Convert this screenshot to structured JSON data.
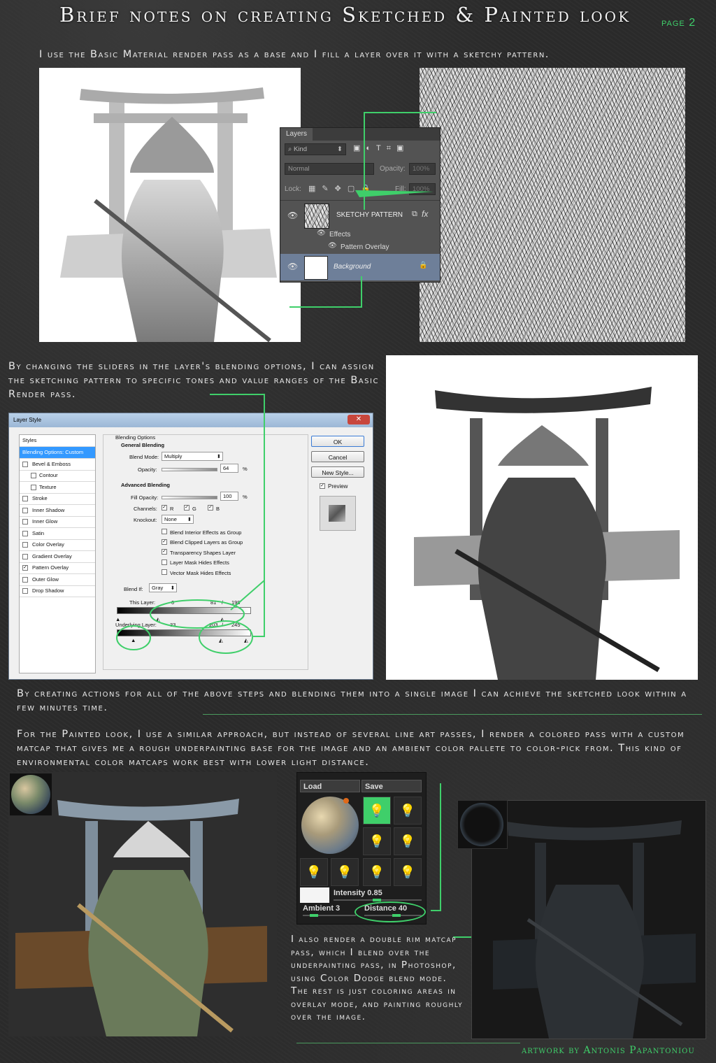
{
  "title": "Brief notes on creating Sketched & Painted look",
  "page_label": "page 2",
  "para1": "I use the Basic Material render pass as a base and I fill a layer over it with a sketchy pattern.",
  "para2": "By changing the sliders in the layer's blending options, I can assign the sketching pattern to specific tones and value ranges of the Basic Render pass.",
  "para3": "By creating actions for all of the above steps and blending them into a single image I can achieve the sketched look within a few minutes time.",
  "para4": "For the Painted look, I use a similar approach, but instead of several line art passes, I render a colored pass with a custom matcap that gives me a rough underpainting base for the image and an ambient color pallete to color-pick from. This kind of environmental color matcaps work best with lower light distance.",
  "para5": "I also render a double rim matcap pass, which I blend over the underpainting pass, in Photoshop, using Color Dodge blend mode.\nThe rest is just coloring areas in overlay mode, and painting roughly over the image.",
  "credit": "artwork by Antonis Papantoniou",
  "layers_panel": {
    "tab": "Layers",
    "kind": "Kind",
    "blend_mode": "Normal",
    "opacity_label": "Opacity:",
    "opacity_value": "100%",
    "lock_label": "Lock:",
    "fill_label": "Fill:",
    "fill_value": "100%",
    "layer1": "SKETCHY PATTERN",
    "fx": "fx",
    "effects": "Effects",
    "effect1": "Pattern Overlay",
    "layer2": "Background"
  },
  "layer_style": {
    "title": "Layer Style",
    "styles_header": "Styles",
    "styles": [
      "Blending Options: Custom",
      "Bevel & Emboss",
      "Contour",
      "Texture",
      "Stroke",
      "Inner Shadow",
      "Inner Glow",
      "Satin",
      "Color Overlay",
      "Gradient Overlay",
      "Pattern Overlay",
      "Outer Glow",
      "Drop Shadow"
    ],
    "section": "Blending Options",
    "general": "General Blending",
    "blend_mode_label": "Blend Mode:",
    "blend_mode": "Multiply",
    "opacity_label": "Opacity:",
    "opacity": "64",
    "pct": "%",
    "advanced": "Advanced Blending",
    "fill_opacity_label": "Fill Opacity:",
    "fill_opacity": "100",
    "channels_label": "Channels:",
    "ch_r": "R",
    "ch_g": "G",
    "ch_b": "B",
    "knockout_label": "Knockout:",
    "knockout": "None",
    "options": [
      "Blend Interior Effects as Group",
      "Blend Clipped Layers as Group",
      "Transparency Shapes Layer",
      "Layer Mask Hides Effects",
      "Vector Mask Hides Effects"
    ],
    "blend_if_label": "Blend If:",
    "blend_if": "Gray",
    "this_layer": "This Layer:",
    "this_vals": [
      "0",
      "81",
      "/",
      "199"
    ],
    "underlying": "Underlying Layer:",
    "under_vals": [
      "33",
      "203",
      "/",
      "245"
    ],
    "ok": "OK",
    "cancel": "Cancel",
    "new_style": "New Style...",
    "preview": "Preview"
  },
  "zbrush": {
    "load": "Load",
    "save": "Save",
    "intensity": "Intensity 0.85",
    "ambient": "Ambient 3",
    "distance": "Distance 40"
  },
  "colors": {
    "accent_green": "#3fcf6a",
    "panel_dark": "#535353",
    "selection": "#6e7f99"
  }
}
